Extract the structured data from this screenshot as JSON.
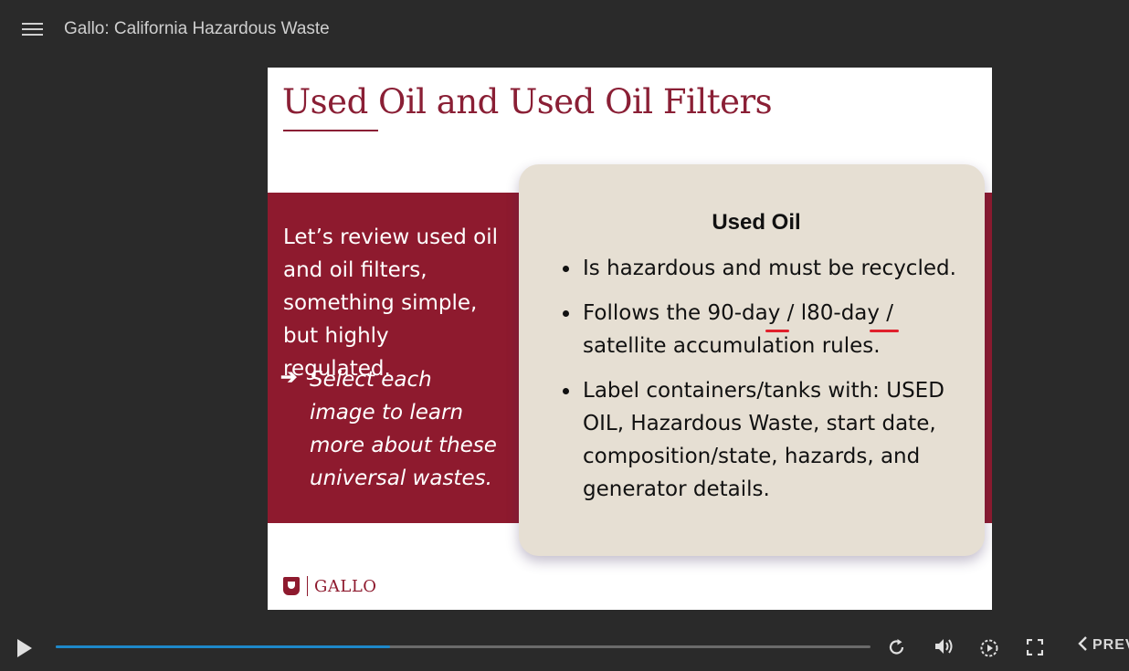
{
  "header": {
    "course_title": "Gallo: California Hazardous Waste"
  },
  "slide": {
    "title": "Used Oil and Used Oil Filters",
    "intro_text": "Let’s review used oil and oil filters, something simple, but highly regulated.",
    "instruction_arrow": "➔",
    "instruction_text": "Select each image to learn more about these universal wastes.",
    "card": {
      "title": "Used Oil",
      "bullets": [
        "Is hazardous and must be recycled.",
        "Follows the 90-day / l80-day / satellite accumulation rules.",
        "Label containers/tanks with: USED OIL, Hazardous Waste, start date, composition/state, hazards, and generator details."
      ]
    },
    "logo_text": "GALLO"
  },
  "player": {
    "progress_fraction": 0.41,
    "prev_label": "PREV"
  },
  "colors": {
    "brand": "#8e1a2e",
    "card_bg": "#e6dfd3",
    "progress": "#1e88c9"
  }
}
